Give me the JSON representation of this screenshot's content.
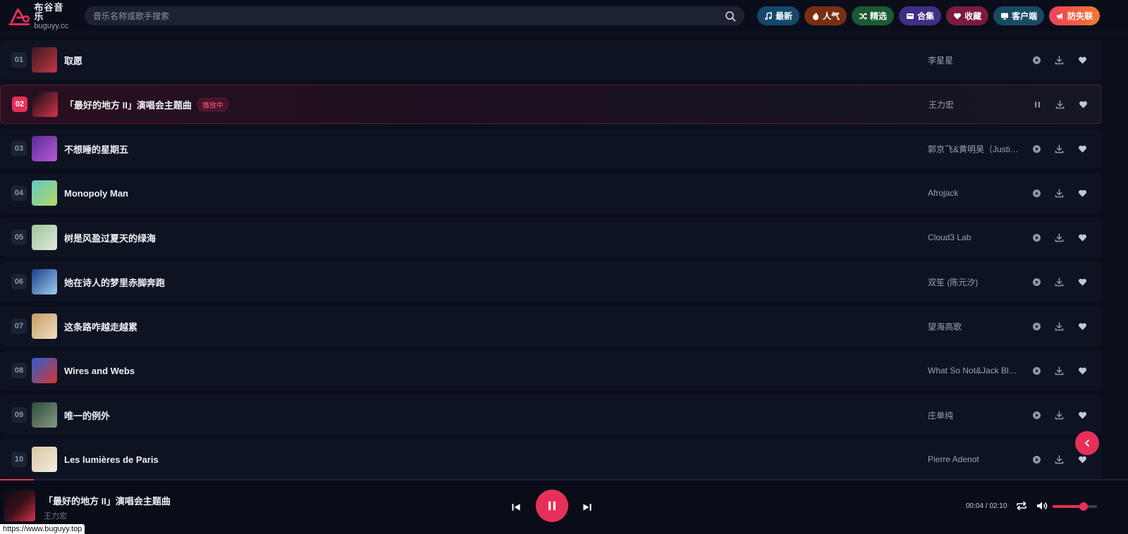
{
  "header": {
    "logo_cn": "布谷音乐",
    "logo_en": "buguyy.cc",
    "search_placeholder": "音乐名称或歌手搜索",
    "nav": [
      {
        "label": "最新",
        "icon": "music-note-icon",
        "color": "#15486b"
      },
      {
        "label": "人气",
        "icon": "fire-icon",
        "color": "#7a2f12"
      },
      {
        "label": "精选",
        "icon": "shuffle-icon",
        "color": "#1a5a32"
      },
      {
        "label": "合集",
        "icon": "collection-icon",
        "color": "#3e2e85"
      },
      {
        "label": "收藏",
        "icon": "heart-icon",
        "color": "#7c1a40"
      },
      {
        "label": "客户端",
        "icon": "monitor-icon",
        "color": "#174b63"
      },
      {
        "label": "防失联",
        "icon": "megaphone-icon",
        "color": "#e84a3d"
      }
    ]
  },
  "songs": [
    {
      "num": "01",
      "title": "取愿",
      "artist": "李星星",
      "playing": false,
      "cover": [
        "#3a1a1e",
        "#c23845"
      ]
    },
    {
      "num": "02",
      "title": "「最好的地方 II」演唱会主题曲",
      "artist": "王力宏",
      "playing": true,
      "badge": "播放中",
      "cover": [
        "#0e0e12",
        "#d6334d"
      ]
    },
    {
      "num": "03",
      "title": "不想睡的星期五",
      "artist": "郭京飞&黄明昊（Justin）",
      "playing": false,
      "cover": [
        "#5b2a9a",
        "#b85ad6"
      ]
    },
    {
      "num": "04",
      "title": "Monopoly Man",
      "artist": "Afrojack",
      "playing": false,
      "cover": [
        "#5fc9c0",
        "#b6d96a"
      ]
    },
    {
      "num": "05",
      "title": "树是风盈过夏天的绿海",
      "artist": "Cloud3 Lab",
      "playing": false,
      "cover": [
        "#9cc49a",
        "#e2eadb"
      ]
    },
    {
      "num": "06",
      "title": "她在诗人的梦里赤脚奔跑",
      "artist": "双笙 (陈元汐)",
      "playing": false,
      "cover": [
        "#1d3b8a",
        "#9fd0ee"
      ]
    },
    {
      "num": "07",
      "title": "这条路咋越走越累",
      "artist": "望海高歌",
      "playing": false,
      "cover": [
        "#c79a62",
        "#efe1c6"
      ]
    },
    {
      "num": "08",
      "title": "Wires and Webs",
      "artist": "What So Not&Jack Black",
      "playing": false,
      "cover": [
        "#2b5fd6",
        "#d8362c"
      ]
    },
    {
      "num": "09",
      "title": "唯一的例外",
      "artist": "庄单纯",
      "playing": false,
      "cover": [
        "#2c4a3a",
        "#8a9a82"
      ]
    },
    {
      "num": "10",
      "title": "Les lumières de Paris",
      "artist": "Pierre Adenot",
      "playing": false,
      "cover": [
        "#d9c6a3",
        "#f2ece0"
      ]
    }
  ],
  "player": {
    "title": "「最好的地方 II」演唱会主题曲",
    "artist": "王力宏",
    "time": "00:04 / 02:10",
    "progress": 0.03,
    "volume": 0.7,
    "accent": "#e6305a"
  },
  "status_url": "https://www.buguyy.top"
}
